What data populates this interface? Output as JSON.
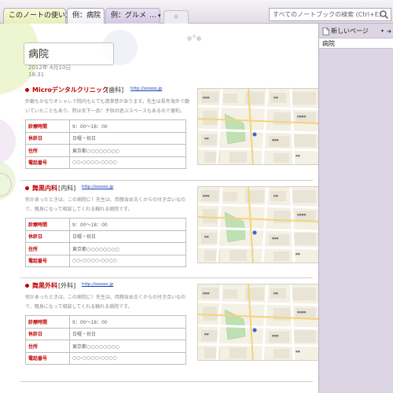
{
  "tabs": [
    {
      "label": "このノートの使い方"
    },
    {
      "label": "例：病院"
    },
    {
      "label": "例：グルメ",
      "more": "…",
      "dropdown": "▾"
    },
    {
      "label": "☼"
    }
  ],
  "search": {
    "placeholder": "すべてのノートブックの検索 (Ctrl+E)"
  },
  "page": {
    "title": "病院",
    "date": "2012年 4月10日",
    "time": "18:31"
  },
  "entries": [
    {
      "name": "Microデンタルクリニック",
      "dept": "[歯科]",
      "link": "http://ooooo.jp",
      "description": "外観もかなりオシャレで院内もとても清潔感があります。先生は長年海外で働いていたこともあり、院は天下一品！子供の遊ぶスペースもあるので便利。",
      "rows": [
        {
          "key": "診療時間",
          "value": "9：00〜18：00"
        },
        {
          "key": "休診日",
          "value": "日曜・祝日"
        },
        {
          "key": "住所",
          "value": "東京都○○○○○○○○"
        },
        {
          "key": "電話番号",
          "value": "○○-○○○○-○○○○"
        }
      ]
    },
    {
      "name": "舞黒内科",
      "dept": "[内科]",
      "link": "http://ooooo.jp",
      "description": "何かあったときは、この病院に！先生は、両親含め古くからの付き合いなので、親身になって相談してくれる頼れる病院です。",
      "rows": [
        {
          "key": "診療時間",
          "value": "9：00〜18：00"
        },
        {
          "key": "休診日",
          "value": "日曜・祝日"
        },
        {
          "key": "住所",
          "value": "東京都○○○○○○○○"
        },
        {
          "key": "電話番号",
          "value": "○○-○○○○-○○○○"
        }
      ]
    },
    {
      "name": "舞黒外科",
      "dept": "[外科]",
      "link": "http://ooooo.jp",
      "description": "何かあったときは、この病院に！先生は、両親含め古くからの付き合いなので、親身になって相談してくれる頼れる病院です。",
      "rows": [
        {
          "key": "診療時間",
          "value": "9：00〜18：00"
        },
        {
          "key": "休診日",
          "value": "日曜・祝日"
        },
        {
          "key": "住所",
          "value": "東京都○○○○○○○○"
        },
        {
          "key": "電話番号",
          "value": "○○-○○○○-○○○○"
        }
      ]
    }
  ],
  "right_pane": {
    "new_page_label": "新しいページ",
    "caret": "▾",
    "arrow": "➔",
    "pages": [
      "病院"
    ]
  },
  "icons": {
    "search": "search-icon",
    "new_page": "page-icon",
    "map": "map-thumbnail"
  },
  "colors": {
    "accent_red": "#c00000",
    "link_blue": "#1a3fb4",
    "pane_bg": "#dcd5e3",
    "tab_active_bg": "#ffffff",
    "tab_first_bg": "#e8efb8",
    "tab_third_bg": "#d3c8e4"
  }
}
